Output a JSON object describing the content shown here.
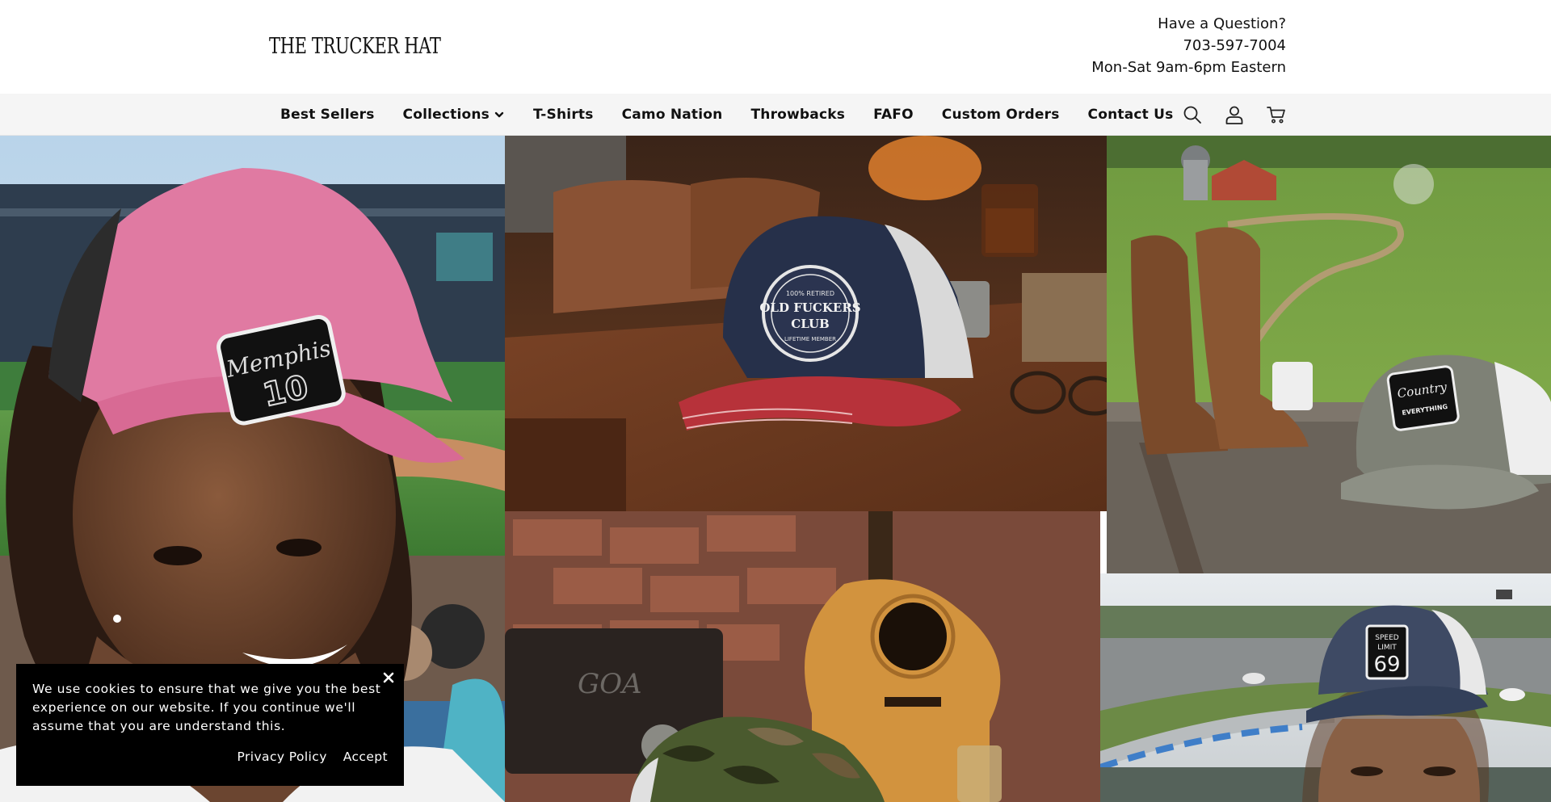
{
  "brand": {
    "logo_text": "THE TRUCKER HAT"
  },
  "contact": {
    "question": "Have a Question?",
    "phone": "703-597-7004",
    "hours": "Mon-Sat 9am-6pm Eastern"
  },
  "nav": {
    "items": [
      {
        "label": "Best Sellers"
      },
      {
        "label": "Collections",
        "has_dropdown": true,
        "icon": "chevron-down-icon"
      },
      {
        "label": "T-Shirts"
      },
      {
        "label": "Camo Nation"
      },
      {
        "label": "Throwbacks"
      },
      {
        "label": "FAFO"
      },
      {
        "label": "Custom Orders"
      },
      {
        "label": "Contact Us"
      }
    ],
    "icons": [
      "search-icon",
      "account-icon",
      "cart-icon"
    ]
  },
  "hero": {
    "photos": [
      {
        "subject": "woman-in-pink-memphis-hat",
        "hat_patch_line1": "Memphis",
        "hat_patch_line2": "10"
      },
      {
        "subject": "navy-red-hat-on-desk",
        "hat_patch_line1": "100% RETIRED",
        "hat_patch_line2": "OLD FUCKERS",
        "hat_patch_line3": "CLUB",
        "hat_patch_line4": "LIFETIME MEMBER"
      },
      {
        "subject": "gray-hat-with-boots",
        "hat_patch_line1": "Country",
        "hat_patch_line2": "EVERYTHING"
      },
      {
        "subject": "camo-hat-with-guitar"
      },
      {
        "subject": "woman-speed-limit-hat",
        "hat_patch_line1": "SPEED",
        "hat_patch_line2": "LIMIT",
        "hat_patch_line3": "69"
      }
    ]
  },
  "cookie_banner": {
    "message": "We use cookies to ensure that we give you the best experience on our website. If you continue we'll assume that you are understand this.",
    "privacy_label": "Privacy Policy",
    "accept_label": "Accept"
  },
  "colors": {
    "navbar_bg": "#f5f5f5",
    "banner_bg": "#000000",
    "text": "#111111"
  }
}
